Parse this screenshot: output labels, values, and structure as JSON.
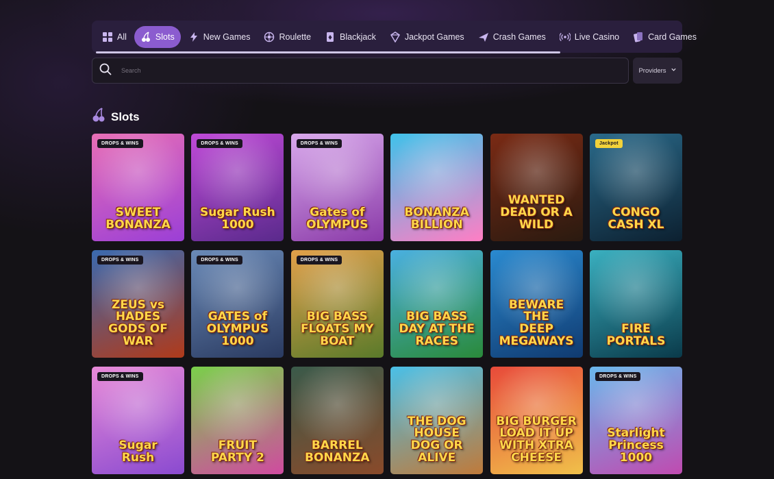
{
  "nav": {
    "tabs": [
      {
        "label": "All",
        "icon": "grid-icon",
        "active": false
      },
      {
        "label": "Slots",
        "icon": "cherry-icon",
        "active": true
      },
      {
        "label": "New Games",
        "icon": "lightning-icon",
        "active": false
      },
      {
        "label": "Roulette",
        "icon": "roulette-icon",
        "active": false
      },
      {
        "label": "Blackjack",
        "icon": "card-icon",
        "active": false
      },
      {
        "label": "Jackpot Games",
        "icon": "jackpot-icon",
        "active": false
      },
      {
        "label": "Crash Games",
        "icon": "plane-icon",
        "active": false
      },
      {
        "label": "Live Casino",
        "icon": "broadcast-icon",
        "active": false
      },
      {
        "label": "Card Games",
        "icon": "cards-icon",
        "active": false
      }
    ],
    "active_color": "#8b5ccf"
  },
  "search": {
    "placeholder": "Search",
    "providers_label": "Providers"
  },
  "section": {
    "title": "Slots",
    "icon": "cherry-icon"
  },
  "games": [
    {
      "title": "SWEET\nBONANZA",
      "badge": "DROPS & WINS",
      "bg": [
        "#e86fb6",
        "#9b3fd6"
      ]
    },
    {
      "title": "Sugar Rush\n1000",
      "badge": "DROPS & WINS",
      "bg": [
        "#c04ad8",
        "#5a2a8c"
      ]
    },
    {
      "title": "Gates of\nOLYMPUS",
      "badge": "DROPS & WINS",
      "bg": [
        "#d9a9ec",
        "#8a3aa8"
      ]
    },
    {
      "title": "BONANZA\nBILLION",
      "badge": "",
      "bg": [
        "#3fc2ea",
        "#ff7ec4"
      ]
    },
    {
      "title": "WANTED\nDEAD OR A WILD",
      "badge": "",
      "bg": [
        "#7a2a14",
        "#2a1a10"
      ]
    },
    {
      "title": "CONGO CASH XL",
      "badge": "Jackpot",
      "bg": [
        "#2a6a8a",
        "#0c2030"
      ]
    },
    {
      "title": "ZEUS vs HADES\nGODS OF WAR",
      "badge": "DROPS & WINS",
      "bg": [
        "#3a6ab0",
        "#b03a1a"
      ]
    },
    {
      "title": "GATES of OLYMPUS\n1000",
      "badge": "DROPS & WINS",
      "bg": [
        "#6a8ab8",
        "#2a3a60"
      ]
    },
    {
      "title": "BIG BASS\nFLOATS MY BOAT",
      "badge": "DROPS & WINS",
      "bg": [
        "#e2a04a",
        "#5a7a2a"
      ]
    },
    {
      "title": "BIG BASS\nDAY AT THE RACES",
      "badge": "",
      "bg": [
        "#4ab0e0",
        "#2a8a3a"
      ]
    },
    {
      "title": "BEWARE THE\nDEEP\nMEGAWAYS",
      "badge": "",
      "bg": [
        "#2a8ad0",
        "#103a70"
      ]
    },
    {
      "title": "FIRE\nPORTALS",
      "badge": "",
      "bg": [
        "#3ab0c0",
        "#0a3a4a"
      ]
    },
    {
      "title": "Sugar\nRush",
      "badge": "DROPS & WINS",
      "bg": [
        "#e88ad8",
        "#8a4ad0"
      ]
    },
    {
      "title": "FRUIT\nPARTY 2",
      "badge": "",
      "bg": [
        "#7ad04a",
        "#d04aa0"
      ]
    },
    {
      "title": "BARREL\nBONANZA",
      "badge": "",
      "bg": [
        "#3a5a4a",
        "#8a4a2a"
      ]
    },
    {
      "title": "THE DOG HOUSE\nDOG OR ALIVE",
      "badge": "",
      "bg": [
        "#4ac0e8",
        "#c07a3a"
      ]
    },
    {
      "title": "BIG BURGER\nLOAD IT UP WITH XTRA CHEESE",
      "badge": "",
      "bg": [
        "#e84a3a",
        "#f0c04a"
      ]
    },
    {
      "title": "Starlight\nPrincess\n1000",
      "badge": "DROPS & WINS",
      "bg": [
        "#6ab8ec",
        "#c04ab0"
      ]
    }
  ]
}
